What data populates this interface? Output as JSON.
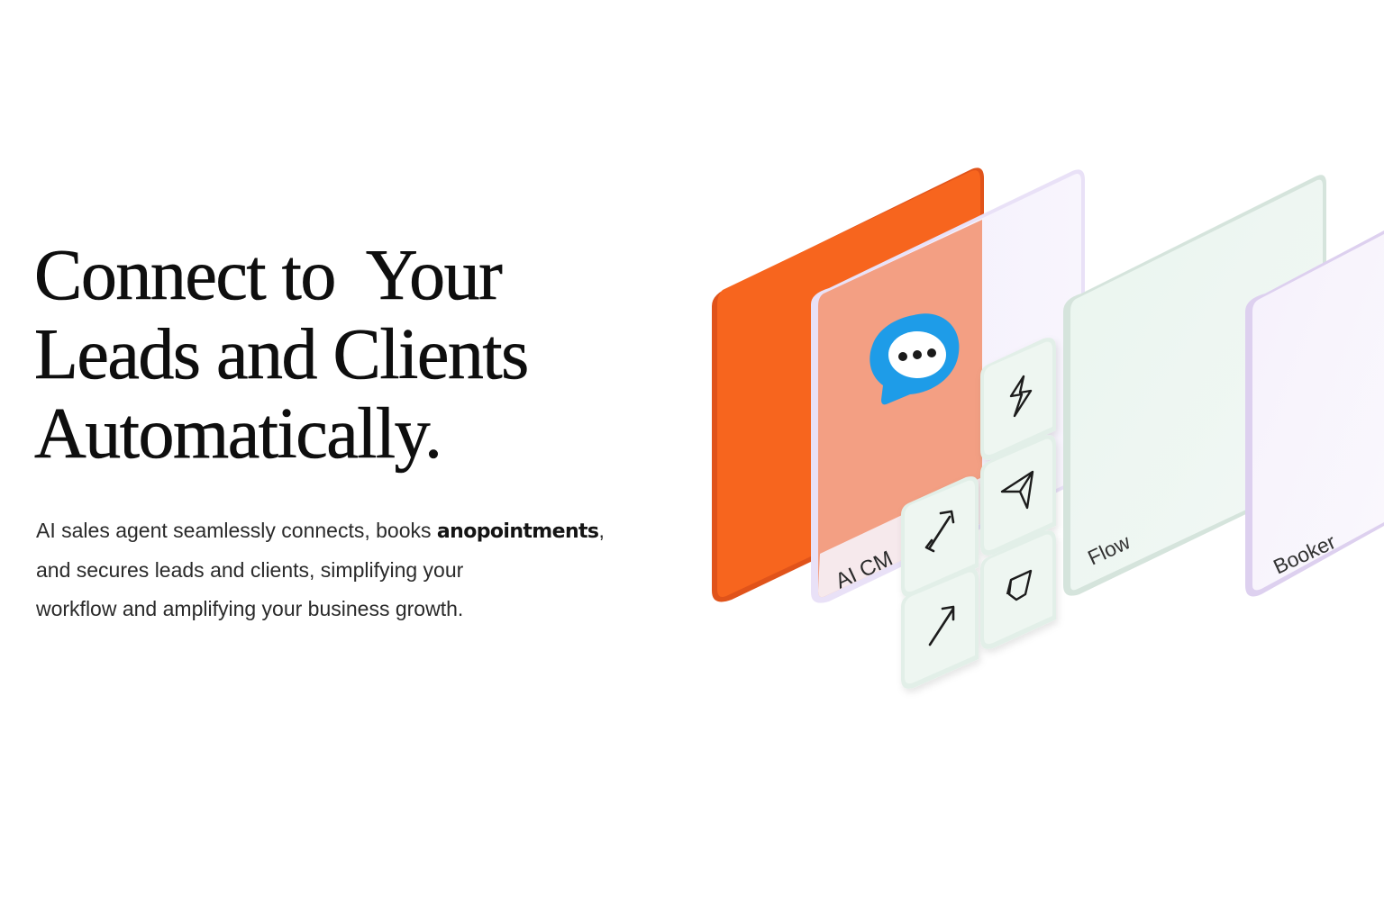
{
  "hero": {
    "headline_line1": "Connect to  Your",
    "headline_line2": "Leads and Clients",
    "headline_line3": "Automatically.",
    "sub_line1_start": "AI sales agent seamlessly connects, books ",
    "sub_line1_emph": "anopointments",
    "sub_line1_end": ",",
    "sub_line2": "and secures leads and clients, simplifying your",
    "sub_line3": "workflow and amplifying your business growth."
  },
  "illustration": {
    "cards": [
      {
        "label": "AI CM"
      },
      {
        "label": "Flow"
      },
      {
        "label": "Booker"
      }
    ],
    "tiles": [
      {
        "icon": "lightning-icon"
      },
      {
        "icon": "send-icon"
      },
      {
        "icon": "link-arrow-icon"
      },
      {
        "icon": "tag-icon"
      },
      {
        "icon": "arrow-up-right-icon"
      }
    ],
    "chat_icon": "chat-bubble-icon",
    "colors": {
      "orange": "#f7651e",
      "peach": "#f29a7c",
      "lavender": "#efe8fb",
      "mint": "#e8f4ee",
      "blue": "#1e9ce8"
    }
  }
}
